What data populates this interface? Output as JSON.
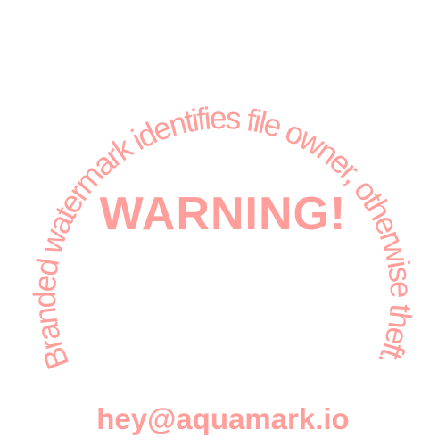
{
  "watermark": {
    "arc_text": "Branded watermark identifies file owner, otherwise theft.",
    "center_text": "WARNING!",
    "contact": "hey@aquamark.io",
    "color": "#ff9e9a",
    "background": "#ffffff"
  }
}
